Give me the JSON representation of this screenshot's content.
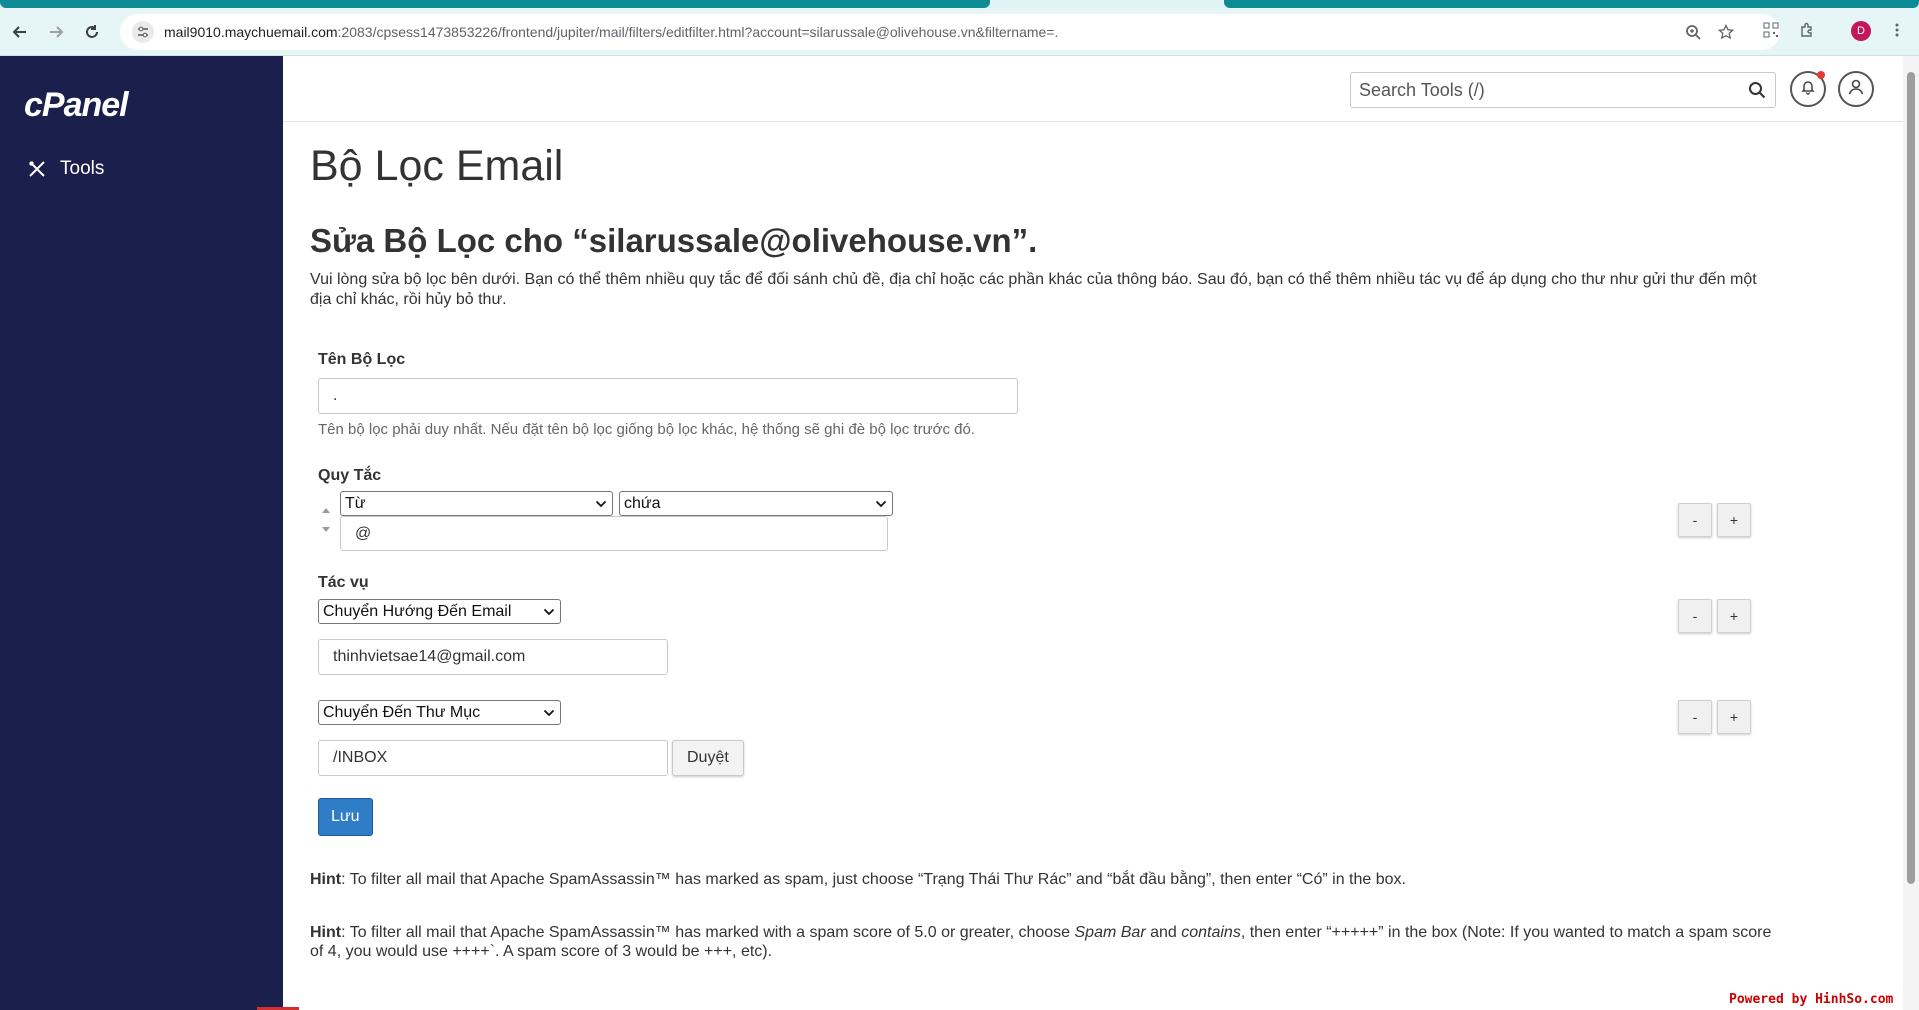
{
  "browser": {
    "url_host": "mail9010.maychuemail.com",
    "url_rest": ":2083/cpsess1473853226/frontend/jupiter/mail/filters/editfilter.html?account=silarussale@olivehouse.vn&filtername=.",
    "profile_initial": "D"
  },
  "sidebar": {
    "logo": "cPanel",
    "items": [
      {
        "label": "Tools",
        "icon": "tools-icon"
      }
    ]
  },
  "header": {
    "search_placeholder": "Search Tools (/)"
  },
  "page": {
    "title": "Bộ Lọc Email",
    "subtitle": "Sửa Bộ Lọc cho “silarussale@olivehouse.vn”.",
    "intro": "Vui lòng sửa bộ lọc bên dưới. Bạn có thể thêm nhiều quy tắc để đối sánh chủ đề, địa chỉ hoặc các phần khác của thông báo. Sau đó, bạn có thể thêm nhiều tác vụ để áp dụng cho thư như gửi thư đến một địa chỉ khác, rồi hủy bỏ thư."
  },
  "filter_name": {
    "label": "Tên Bộ Lọc",
    "value": ".",
    "help": "Tên bộ lọc phải duy nhất. Nếu đặt tên bộ lọc giống bộ lọc khác, hệ thống sẽ ghi đè bộ lọc trước đó."
  },
  "rules": {
    "label": "Quy Tắc",
    "part": "Từ",
    "match": "chứa",
    "value": "@",
    "remove_label": "-",
    "add_label": "+"
  },
  "actions": {
    "label": "Tác vụ",
    "items": [
      {
        "action": "Chuyển Hướng Đến Email",
        "value": "thinhvietsae14@gmail.com"
      },
      {
        "action": "Chuyển Đến Thư Mục",
        "value": "/INBOX",
        "browse_label": "Duyệt"
      }
    ],
    "remove_label": "-",
    "add_label": "+"
  },
  "save_label": "Lưu",
  "hints": [
    {
      "prefix": "Hint",
      "text": ": To filter all mail that Apache SpamAssassin™ has marked as spam, just choose “Trạng Thái Thư Rác” and “bắt đầu bằng”, then enter “Có” in the box."
    },
    {
      "prefix": "Hint",
      "part1": ": To filter all mail that Apache SpamAssassin™ has marked with a spam score of 5.0 or greater, choose ",
      "em1": "Spam Bar",
      "part2": " and ",
      "em2": "contains",
      "part3": ", then enter “+++++” in the box (Note: If you wanted to match a spam score of 4, you would use ++++`. A spam score of 3 would be +++, etc)."
    }
  ],
  "powered_by": "Powered by HinhSo.com",
  "colors": {
    "sidebar": "#1b1f4c",
    "save_button": "#2f7dc7",
    "browser_chrome": "#e6f6f7",
    "tab_accent": "#0d8b95"
  }
}
